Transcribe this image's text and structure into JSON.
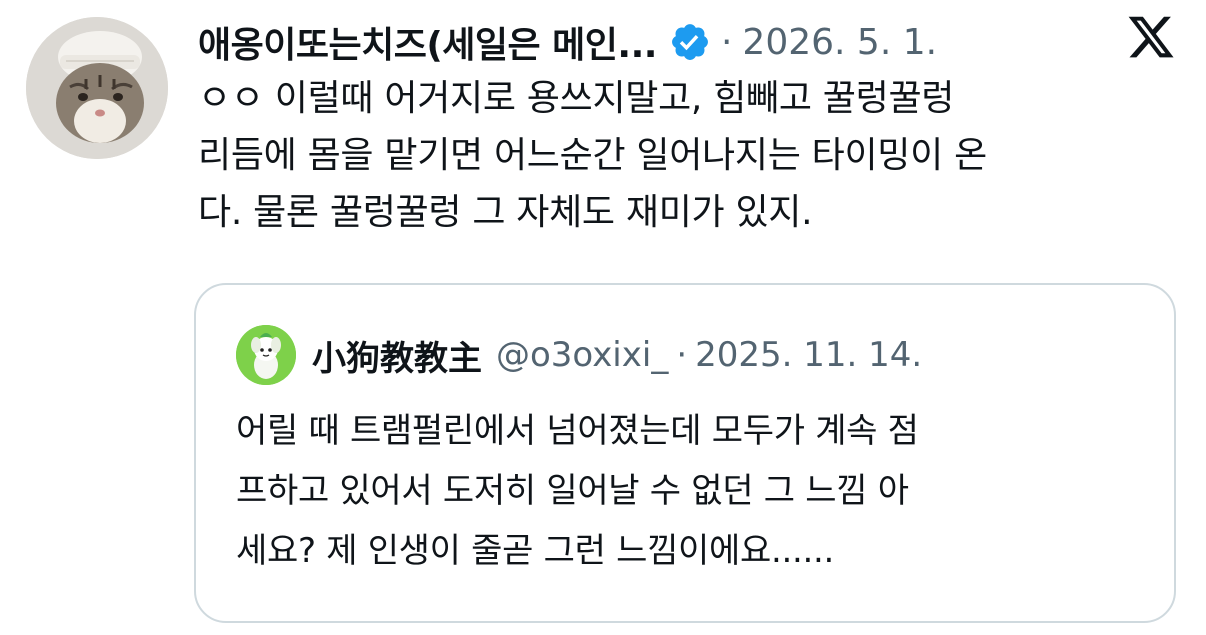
{
  "post": {
    "display_name": "애옹이또는치즈(세일은 메인...",
    "separator": "·",
    "date": "2026. 5. 1.",
    "text_lines": [
      "ㅇㅇ 이럴때 어거지로 용쓰지말고, 힘빼고 꿀렁꿀렁",
      "리듬에 몸을 맡기면 어느순간 일어나지는 타이밍이 온",
      "다. 물론 꿀렁꿀렁 그 자체도 재미가 있지."
    ],
    "verified_color": "#1d9bf0"
  },
  "quote": {
    "display_name": "小狗教教主",
    "handle": "@o3oxixi_",
    "separator": "·",
    "date": "2025. 11. 14.",
    "text_lines": [
      "어릴 때 트램펄린에서 넘어졌는데 모두가 계속 점",
      "프하고 있어서 도저히 일어날 수 없던 그 느낌 아",
      "세요? 제 인생이 줄곧 그런 느낌이에요......"
    ]
  },
  "icons": {
    "verified": "verified-badge-icon",
    "brand": "x-logo-icon"
  },
  "colors": {
    "text_primary": "#0f1419",
    "text_secondary": "#536471",
    "border": "#cfd9de"
  }
}
